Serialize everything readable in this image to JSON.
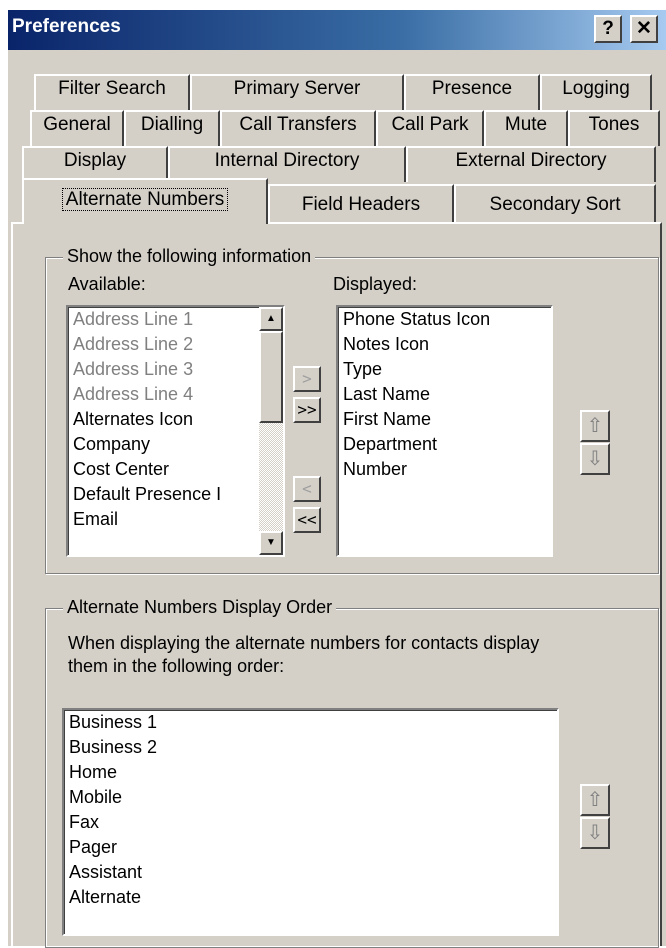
{
  "window": {
    "title": "Preferences",
    "help_label": "?",
    "close_label": "✕"
  },
  "tabs": {
    "row1": [
      "Filter Search",
      "Primary Server",
      "Presence",
      "Logging"
    ],
    "row2": [
      "General",
      "Dialling",
      "Call Transfers",
      "Call Park",
      "Mute",
      "Tones"
    ],
    "row3": [
      "Display",
      "Internal Directory",
      "External Directory"
    ],
    "row4": [
      "Alternate Numbers",
      "Field Headers",
      "Secondary Sort"
    ],
    "active": "Alternate Numbers"
  },
  "show_info": {
    "group_label": "Show the following information",
    "available_label": "Available:",
    "displayed_label": "Displayed:",
    "available": [
      {
        "text": "Address Line 1",
        "dim": true
      },
      {
        "text": "Address Line 2",
        "dim": true
      },
      {
        "text": "Address Line 3",
        "dim": true
      },
      {
        "text": "Address Line 4",
        "dim": true
      },
      {
        "text": "Alternates Icon",
        "dim": false
      },
      {
        "text": "Company",
        "dim": false
      },
      {
        "text": "Cost Center",
        "dim": false
      },
      {
        "text": "Default Presence I",
        "dim": false
      },
      {
        "text": "Email",
        "dim": false
      }
    ],
    "displayed": [
      "Phone Status Icon",
      "Notes Icon",
      "Type",
      "Last Name",
      "First Name",
      "Department",
      "Number"
    ],
    "buttons": {
      "add": ">",
      "add_all": ">>",
      "remove": "<",
      "remove_all": "<<"
    },
    "scroll_up": "▲",
    "scroll_down": "▼",
    "move_up": "⇧",
    "move_down": "⇩"
  },
  "alt_order": {
    "group_label": "Alternate Numbers Display Order",
    "description": "When displaying the alternate numbers for contacts display them in the following order:",
    "items": [
      "Business 1",
      "Business 2",
      "Home",
      "Mobile",
      "Fax",
      "Pager",
      "Assistant",
      "Alternate"
    ],
    "move_up": "⇧",
    "move_down": "⇩"
  }
}
